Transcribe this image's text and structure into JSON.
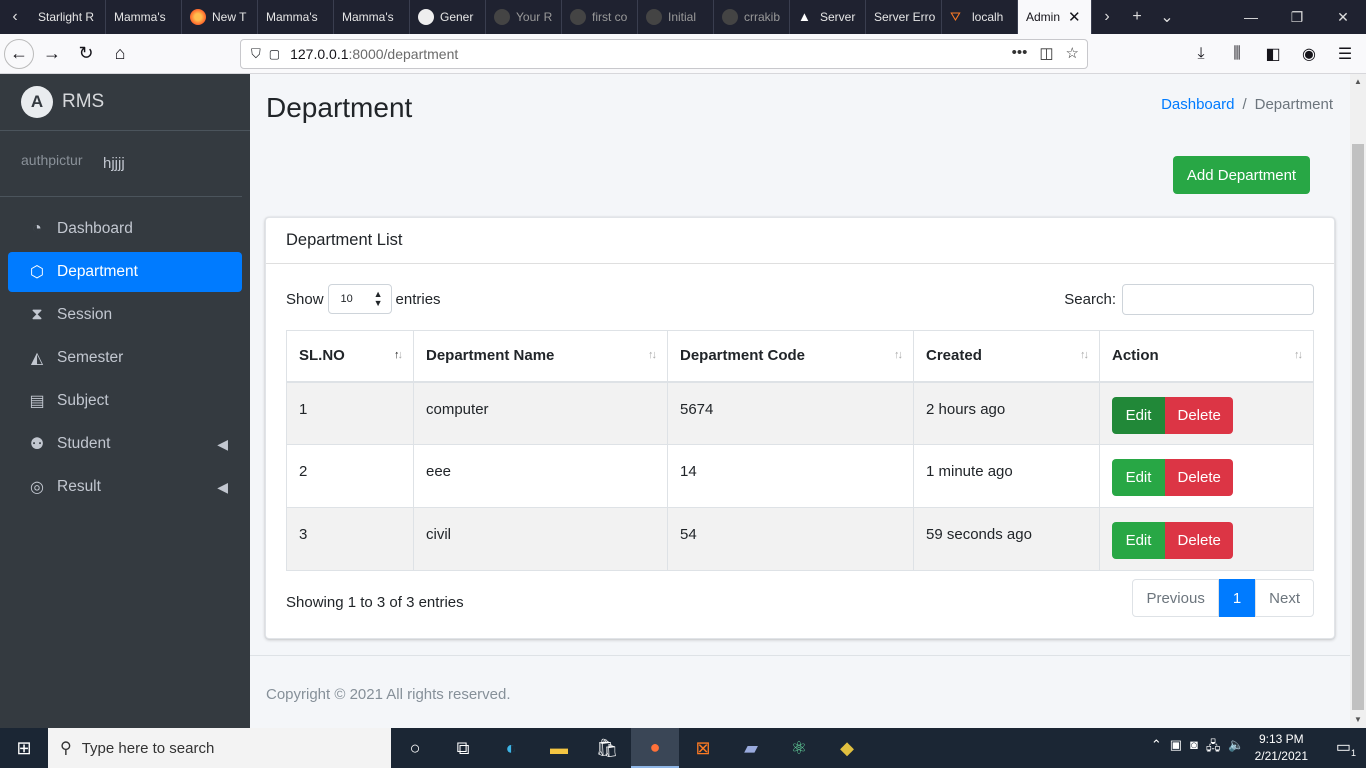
{
  "browser": {
    "tabs": [
      {
        "label": "Starlight R",
        "icon": "page-icon"
      },
      {
        "label": "Mamma's",
        "icon": "page-icon"
      },
      {
        "label": "New T",
        "icon": "firefox-icon"
      },
      {
        "label": "Mamma's",
        "icon": "page-icon"
      },
      {
        "label": "Mamma's",
        "icon": "page-icon"
      },
      {
        "label": "Gener",
        "icon": "github-icon"
      },
      {
        "label": "Your R",
        "icon": "github-icon"
      },
      {
        "label": "first co",
        "icon": "github-icon"
      },
      {
        "label": "Initial",
        "icon": "github-icon"
      },
      {
        "label": "crrakib",
        "icon": "github-icon"
      },
      {
        "label": "Server",
        "icon": "warning-icon"
      },
      {
        "label": "Server Erro",
        "icon": "page-icon"
      },
      {
        "label": "localh",
        "icon": "xampp-icon"
      },
      {
        "label": "Admin",
        "icon": "page-icon",
        "active": true
      }
    ],
    "url_host": "127.0.0.1",
    "url_path": ":8000/department"
  },
  "sidebar": {
    "brand": "RMS",
    "brand_logo_letter": "A",
    "user_picture_alt": "authpictur",
    "user_name": "hjjjj",
    "items": [
      {
        "label": "Dashboard",
        "icon": "tachometer-icon"
      },
      {
        "label": "Department",
        "icon": "codepen-icon",
        "active": true
      },
      {
        "label": "Session",
        "icon": "hourglass-icon"
      },
      {
        "label": "Semester",
        "icon": "mountain-icon"
      },
      {
        "label": "Subject",
        "icon": "book-icon"
      },
      {
        "label": "Student",
        "icon": "users-icon",
        "has_submenu": true
      },
      {
        "label": "Result",
        "icon": "swirl-icon",
        "has_submenu": true
      }
    ]
  },
  "page": {
    "title": "Department",
    "breadcrumb": {
      "home": "Dashboard",
      "sep": "/",
      "current": "Department"
    },
    "add_button": "Add Department"
  },
  "card": {
    "title": "Department List",
    "show_label": "Show",
    "entries_value": "10",
    "entries_label": "entries",
    "search_label": "Search:",
    "search_value": "",
    "columns": [
      "SL.NO",
      "Department Name",
      "Department Code",
      "Created",
      "Action"
    ],
    "rows": [
      {
        "sl": "1",
        "name": "computer",
        "code": "5674",
        "created": "2 hours ago"
      },
      {
        "sl": "2",
        "name": "eee",
        "code": "14",
        "created": "1 minute ago"
      },
      {
        "sl": "3",
        "name": "civil",
        "code": "54",
        "created": "59 seconds ago"
      }
    ],
    "edit_label": "Edit",
    "delete_label": "Delete",
    "info": "Showing 1 to 3 of 3 entries",
    "pagination": {
      "prev": "Previous",
      "current": "1",
      "next": "Next"
    }
  },
  "footer": {
    "text": "Copyright © 2021 All rights reserved."
  },
  "taskbar": {
    "search_placeholder": "Type here to search",
    "time": "9:13 PM",
    "date": "2/21/2021",
    "notification_count": "1"
  }
}
